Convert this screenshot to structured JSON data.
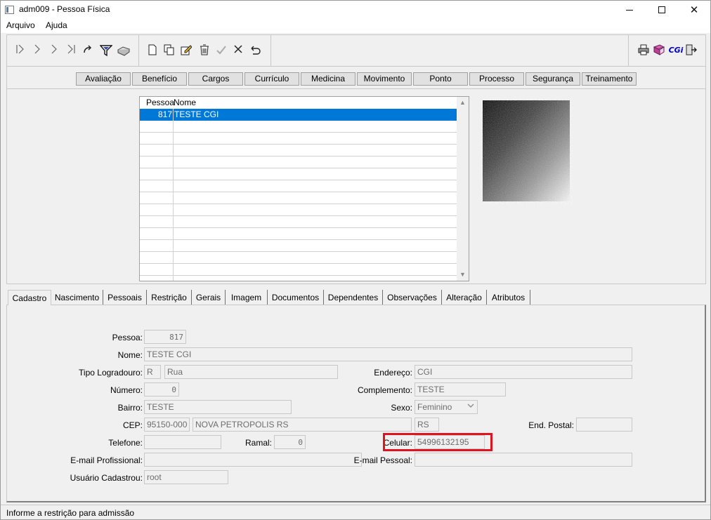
{
  "window": {
    "title": "adm009 - Pessoa Física",
    "minimize": "—",
    "maximize": "☐",
    "close": "✕"
  },
  "menu": {
    "items": [
      "Arquivo",
      "Ajuda"
    ]
  },
  "toolbar": {
    "nav_icons": [
      "first-record-icon",
      "previous-record-icon",
      "next-record-icon",
      "last-record-icon",
      "refresh-icon",
      "filter-icon",
      "clear-filter-icon"
    ],
    "edit_icons": [
      "new-icon",
      "copy-icon",
      "edit-icon",
      "delete-icon",
      "confirm-icon",
      "cancel-icon",
      "undo-icon"
    ],
    "right_icons": [
      "print-icon",
      "book-icon",
      "cgi-logo",
      "exit-icon"
    ],
    "cgi_label": "CGi"
  },
  "modules": [
    "Avaliação",
    "Benefício",
    "Cargos",
    "Currículo",
    "Medicina",
    "Movimento",
    "Ponto",
    "Processo",
    "Segurança",
    "Treinamento"
  ],
  "grid": {
    "columns": [
      "Pessoa",
      "Nome"
    ],
    "rows": [
      {
        "pessoa": "817",
        "nome": "TESTE CGI"
      }
    ]
  },
  "tabs": [
    "Cadastro",
    "Nascimento",
    "Pessoais",
    "Restrição",
    "Gerais",
    "Imagem",
    "Documentos",
    "Dependentes",
    "Observações",
    "Alteração",
    "Atributos"
  ],
  "form": {
    "pessoa": {
      "label": "Pessoa:",
      "value": "817"
    },
    "nome": {
      "label": "Nome:",
      "value": "TESTE CGI"
    },
    "tipo_logradouro": {
      "label": "Tipo Logradouro:",
      "code": "R",
      "value": "Rua"
    },
    "endereco": {
      "label": "Endereço:",
      "value": "CGI"
    },
    "numero": {
      "label": "Número:",
      "value": "0"
    },
    "complemento": {
      "label": "Complemento:",
      "value": "TESTE"
    },
    "bairro": {
      "label": "Bairro:",
      "value": "TESTE"
    },
    "sexo": {
      "label": "Sexo:",
      "value": "Feminino"
    },
    "cep": {
      "label": "CEP:",
      "value": "95150-000",
      "cidade": "NOVA PETROPOLIS RS",
      "uf": "RS"
    },
    "end_postal": {
      "label": "End. Postal:",
      "value": ""
    },
    "telefone": {
      "label": "Telefone:",
      "value": ""
    },
    "ramal": {
      "label": "Ramal:",
      "value": "0"
    },
    "celular": {
      "label": "Celular:",
      "value": "54996132195"
    },
    "email_profissional": {
      "label": "E-mail Profissional:",
      "value": ""
    },
    "email_pessoal": {
      "label": "E-mail Pessoal:",
      "value": ""
    },
    "usuario_cadastrou": {
      "label": "Usuário Cadastrou:",
      "value": "root"
    }
  },
  "status": {
    "text": "Informe a restrição para admissão"
  },
  "colors": {
    "selection": "#0078d7",
    "highlight": "#e0141e",
    "cgi_logo": "#0000c8"
  }
}
